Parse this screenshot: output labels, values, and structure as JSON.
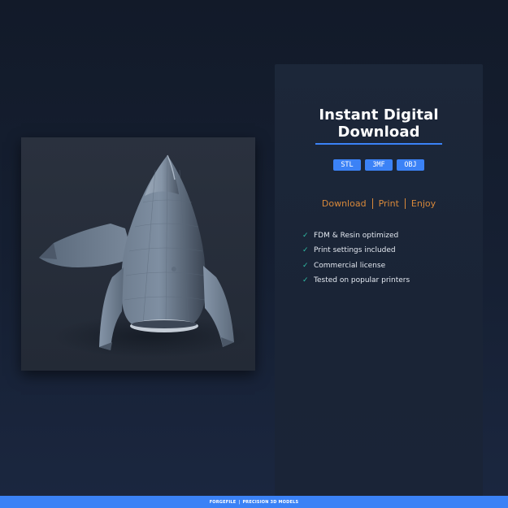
{
  "product": {
    "image_alt": "rocket-3d-model-render"
  },
  "card": {
    "title_line1": "Instant Digital",
    "title_line2": "Download",
    "formats": [
      "STL",
      "3MF",
      "OBJ"
    ],
    "tagline": {
      "download": "Download",
      "print": "Print",
      "enjoy": "Enjoy"
    },
    "features": [
      "FDM & Resin optimized",
      "Print settings included",
      "Commercial license",
      "Tested on popular printers"
    ],
    "check_icon": "✓"
  },
  "footer": {
    "brand": "FORGEFILE",
    "separator": "|",
    "tagline": "PRECISION 3D MODELS"
  },
  "colors": {
    "accent": "#3b82f6",
    "tagline": "#d9893a",
    "check": "#2fbfa6",
    "background": "#162033",
    "card": "#1c2739"
  }
}
